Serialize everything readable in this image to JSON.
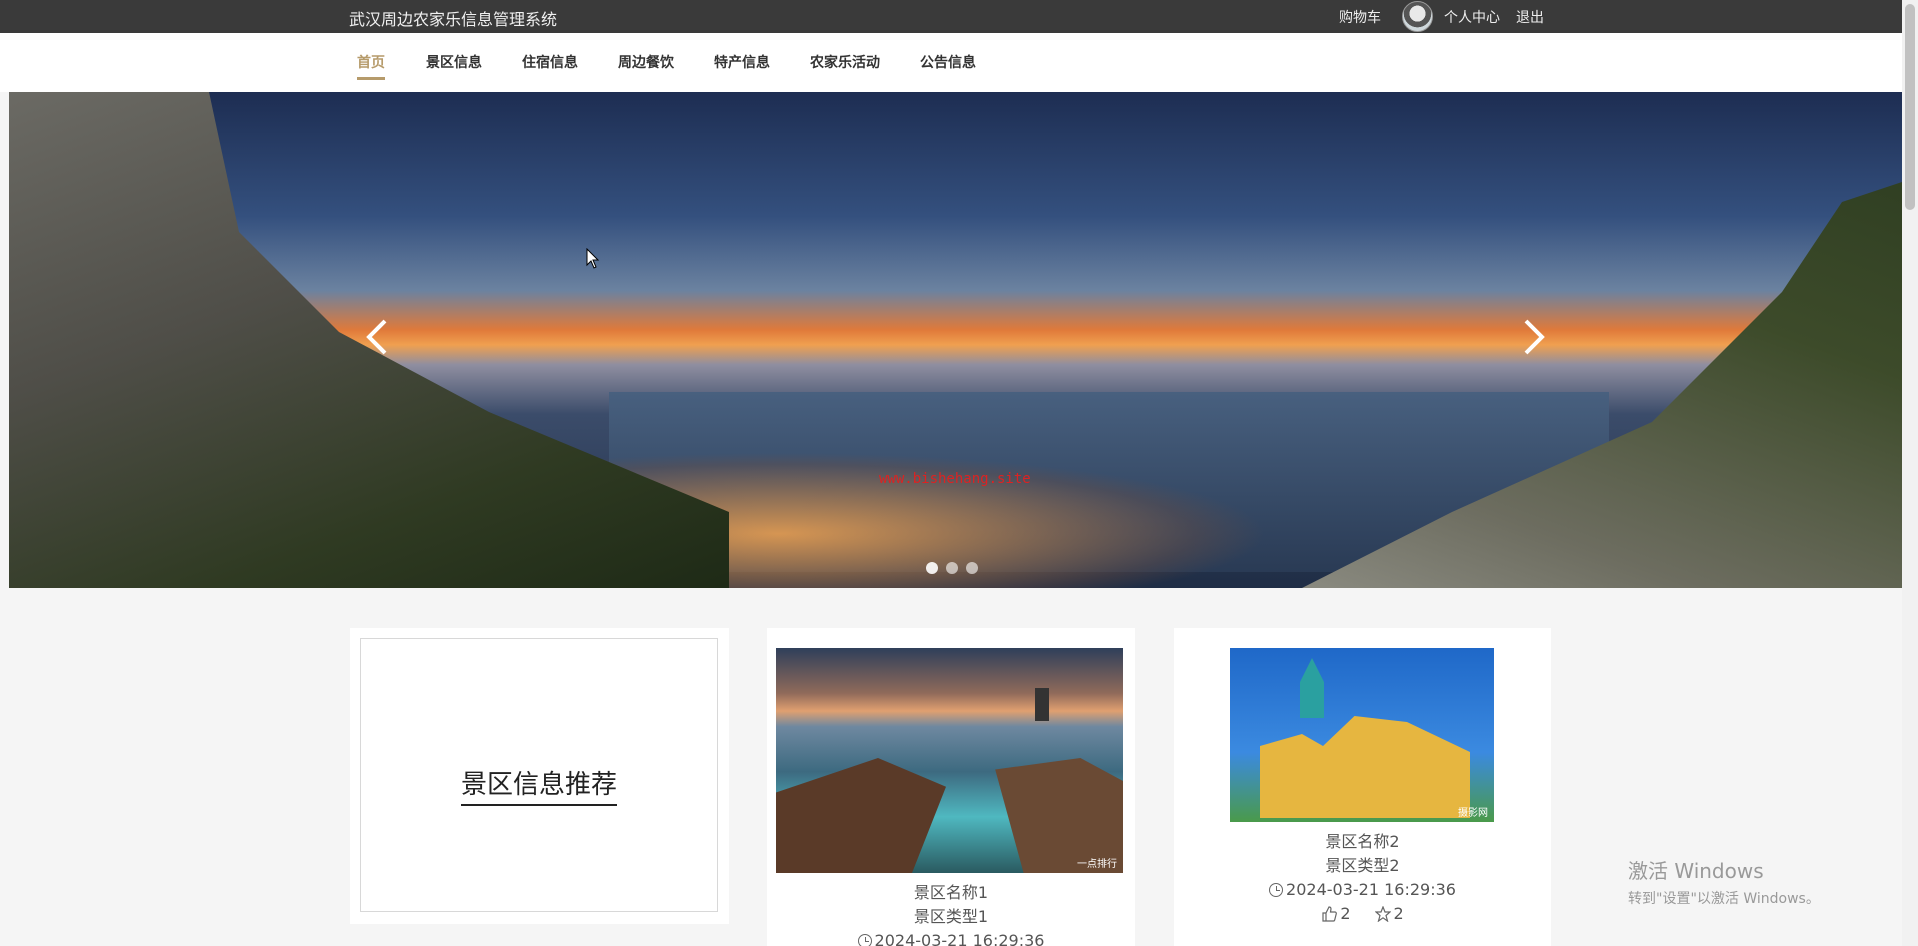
{
  "header": {
    "site_title": "武汉周边农家乐信息管理系统",
    "cart": "购物车",
    "user_center": "个人中心",
    "logout": "退出"
  },
  "nav": {
    "items": [
      {
        "label": "首页",
        "active": true
      },
      {
        "label": "景区信息"
      },
      {
        "label": "住宿信息"
      },
      {
        "label": "周边餐饮"
      },
      {
        "label": "特产信息"
      },
      {
        "label": "农家乐活动"
      },
      {
        "label": "公告信息"
      }
    ]
  },
  "banner": {
    "watermark": "www.bishehang.site",
    "slide_count": 3,
    "active_slide": 1
  },
  "recommend": {
    "title": "景区信息推荐",
    "items": [
      {
        "name": "景区名称1",
        "type": "景区类型1",
        "time": "2024-03-21 16:29:36",
        "photo_tag": "一点排行"
      },
      {
        "name": "景区名称2",
        "type": "景区类型2",
        "time": "2024-03-21 16:29:36",
        "likes": "2",
        "favorites": "2",
        "photo_tag": "摄影网"
      }
    ]
  },
  "os_watermark": {
    "line1": "激活 Windows",
    "line2": "转到\"设置\"以激活 Windows。"
  },
  "colors": {
    "topbar": "#3a3a3a",
    "accent": "#b69b6b"
  }
}
